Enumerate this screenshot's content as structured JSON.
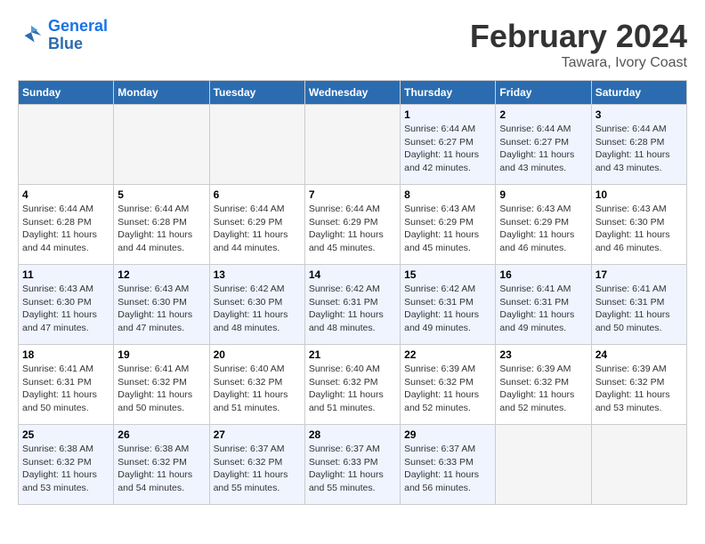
{
  "header": {
    "logo_line1": "General",
    "logo_line2": "Blue",
    "month": "February 2024",
    "location": "Tawara, Ivory Coast"
  },
  "days_of_week": [
    "Sunday",
    "Monday",
    "Tuesday",
    "Wednesday",
    "Thursday",
    "Friday",
    "Saturday"
  ],
  "weeks": [
    [
      {
        "day": "",
        "info": ""
      },
      {
        "day": "",
        "info": ""
      },
      {
        "day": "",
        "info": ""
      },
      {
        "day": "",
        "info": ""
      },
      {
        "day": "1",
        "info": "Sunrise: 6:44 AM\nSunset: 6:27 PM\nDaylight: 11 hours and 42 minutes."
      },
      {
        "day": "2",
        "info": "Sunrise: 6:44 AM\nSunset: 6:27 PM\nDaylight: 11 hours and 43 minutes."
      },
      {
        "day": "3",
        "info": "Sunrise: 6:44 AM\nSunset: 6:28 PM\nDaylight: 11 hours and 43 minutes."
      }
    ],
    [
      {
        "day": "4",
        "info": "Sunrise: 6:44 AM\nSunset: 6:28 PM\nDaylight: 11 hours and 44 minutes."
      },
      {
        "day": "5",
        "info": "Sunrise: 6:44 AM\nSunset: 6:28 PM\nDaylight: 11 hours and 44 minutes."
      },
      {
        "day": "6",
        "info": "Sunrise: 6:44 AM\nSunset: 6:29 PM\nDaylight: 11 hours and 44 minutes."
      },
      {
        "day": "7",
        "info": "Sunrise: 6:44 AM\nSunset: 6:29 PM\nDaylight: 11 hours and 45 minutes."
      },
      {
        "day": "8",
        "info": "Sunrise: 6:43 AM\nSunset: 6:29 PM\nDaylight: 11 hours and 45 minutes."
      },
      {
        "day": "9",
        "info": "Sunrise: 6:43 AM\nSunset: 6:29 PM\nDaylight: 11 hours and 46 minutes."
      },
      {
        "day": "10",
        "info": "Sunrise: 6:43 AM\nSunset: 6:30 PM\nDaylight: 11 hours and 46 minutes."
      }
    ],
    [
      {
        "day": "11",
        "info": "Sunrise: 6:43 AM\nSunset: 6:30 PM\nDaylight: 11 hours and 47 minutes."
      },
      {
        "day": "12",
        "info": "Sunrise: 6:43 AM\nSunset: 6:30 PM\nDaylight: 11 hours and 47 minutes."
      },
      {
        "day": "13",
        "info": "Sunrise: 6:42 AM\nSunset: 6:30 PM\nDaylight: 11 hours and 48 minutes."
      },
      {
        "day": "14",
        "info": "Sunrise: 6:42 AM\nSunset: 6:31 PM\nDaylight: 11 hours and 48 minutes."
      },
      {
        "day": "15",
        "info": "Sunrise: 6:42 AM\nSunset: 6:31 PM\nDaylight: 11 hours and 49 minutes."
      },
      {
        "day": "16",
        "info": "Sunrise: 6:41 AM\nSunset: 6:31 PM\nDaylight: 11 hours and 49 minutes."
      },
      {
        "day": "17",
        "info": "Sunrise: 6:41 AM\nSunset: 6:31 PM\nDaylight: 11 hours and 50 minutes."
      }
    ],
    [
      {
        "day": "18",
        "info": "Sunrise: 6:41 AM\nSunset: 6:31 PM\nDaylight: 11 hours and 50 minutes."
      },
      {
        "day": "19",
        "info": "Sunrise: 6:41 AM\nSunset: 6:32 PM\nDaylight: 11 hours and 50 minutes."
      },
      {
        "day": "20",
        "info": "Sunrise: 6:40 AM\nSunset: 6:32 PM\nDaylight: 11 hours and 51 minutes."
      },
      {
        "day": "21",
        "info": "Sunrise: 6:40 AM\nSunset: 6:32 PM\nDaylight: 11 hours and 51 minutes."
      },
      {
        "day": "22",
        "info": "Sunrise: 6:39 AM\nSunset: 6:32 PM\nDaylight: 11 hours and 52 minutes."
      },
      {
        "day": "23",
        "info": "Sunrise: 6:39 AM\nSunset: 6:32 PM\nDaylight: 11 hours and 52 minutes."
      },
      {
        "day": "24",
        "info": "Sunrise: 6:39 AM\nSunset: 6:32 PM\nDaylight: 11 hours and 53 minutes."
      }
    ],
    [
      {
        "day": "25",
        "info": "Sunrise: 6:38 AM\nSunset: 6:32 PM\nDaylight: 11 hours and 53 minutes."
      },
      {
        "day": "26",
        "info": "Sunrise: 6:38 AM\nSunset: 6:32 PM\nDaylight: 11 hours and 54 minutes."
      },
      {
        "day": "27",
        "info": "Sunrise: 6:37 AM\nSunset: 6:32 PM\nDaylight: 11 hours and 55 minutes."
      },
      {
        "day": "28",
        "info": "Sunrise: 6:37 AM\nSunset: 6:33 PM\nDaylight: 11 hours and 55 minutes."
      },
      {
        "day": "29",
        "info": "Sunrise: 6:37 AM\nSunset: 6:33 PM\nDaylight: 11 hours and 56 minutes."
      },
      {
        "day": "",
        "info": ""
      },
      {
        "day": "",
        "info": ""
      }
    ]
  ]
}
